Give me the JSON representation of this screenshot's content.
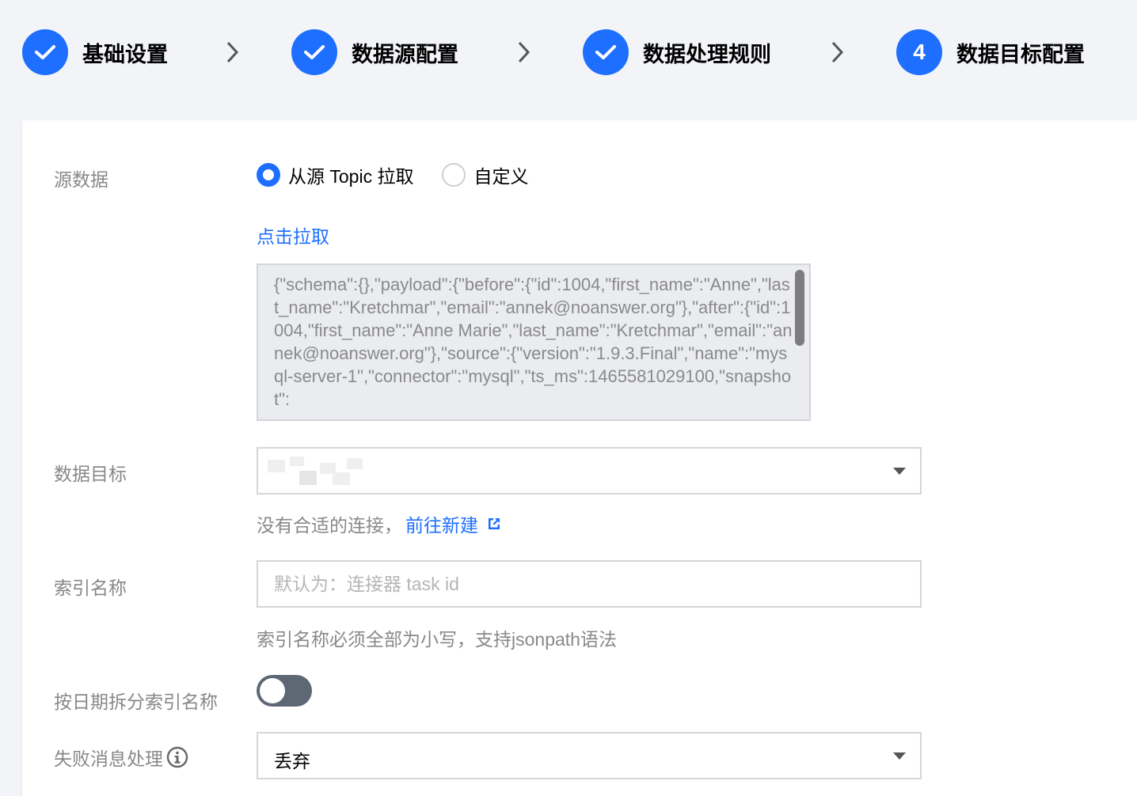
{
  "steps": [
    {
      "label": "基础设置",
      "status": "done"
    },
    {
      "label": "数据源配置",
      "status": "done"
    },
    {
      "label": "数据处理规则",
      "status": "done"
    },
    {
      "label": "数据目标配置",
      "status": "current",
      "number": "4"
    }
  ],
  "form": {
    "source": {
      "label": "源数据",
      "options": [
        "从源 Topic 拉取",
        "自定义"
      ],
      "selected": "从源 Topic 拉取",
      "pull_link": "点击拉取",
      "json_text": "{\"schema\":{},\"payload\":{\"before\":{\"id\":1004,\"first_name\":\"Anne\",\"last_name\":\"Kretchmar\",\"email\":\"annek@noanswer.org\"},\"after\":{\"id\":1004,\"first_name\":\"Anne Marie\",\"last_name\":\"Kretchmar\",\"email\":\"annek@noanswer.org\"},\"source\":{\"version\":\"1.9.3.Final\",\"name\":\"mysql-server-1\",\"connector\":\"mysql\",\"ts_ms\":1465581029100,\"snapshot\":"
    },
    "target": {
      "label": "数据目标",
      "hint": "没有合适的连接，",
      "hint_link": "前往新建"
    },
    "index": {
      "label": "索引名称",
      "placeholder": "默认为：连接器 task id",
      "value": "",
      "hint": "索引名称必须全部为小写，支持jsonpath语法"
    },
    "split_by_date": {
      "label": "按日期拆分索引名称",
      "enabled": false
    },
    "failure": {
      "label": "失败消息处理",
      "value": "丢弃"
    }
  },
  "colors": {
    "primary": "#1e6fff",
    "page_bg": "#f2f4f8",
    "label_gray": "#888888"
  }
}
